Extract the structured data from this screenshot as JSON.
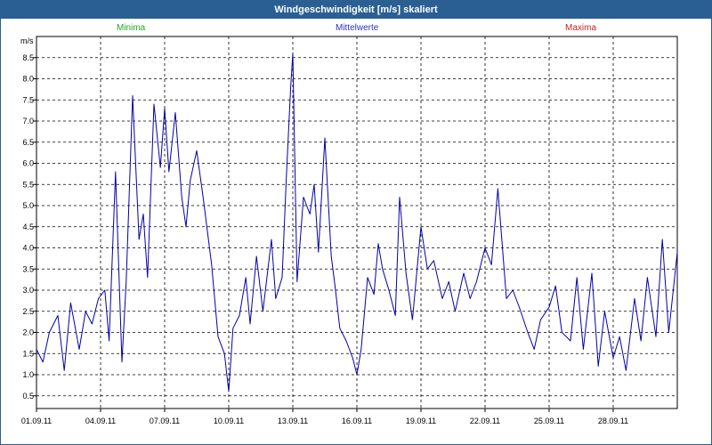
{
  "window": {
    "title": "Windgeschwindigkeit [m/s] skaliert"
  },
  "legend": {
    "min": "Minima",
    "mean": "Mittelwerte",
    "max": "Maxima"
  },
  "colors": {
    "min": "#22aa22",
    "mean": "#3030cc",
    "max": "#cc2222",
    "series": "#0000aa",
    "title_bg": "#2a5f93"
  },
  "chart_data": {
    "type": "line",
    "title": "Windgeschwindigkeit [m/s] skaliert",
    "ylabel": "m/s",
    "xlabel": "",
    "ylim": [
      0.2,
      9.0
    ],
    "y_ticks": [
      0.5,
      1.0,
      1.5,
      2.0,
      2.5,
      3.0,
      3.5,
      4.0,
      4.5,
      5.0,
      5.5,
      6.0,
      6.5,
      7.0,
      7.5,
      8.0,
      8.5
    ],
    "y_tick_labels": [
      "0.5",
      "1.0",
      "1.5",
      "2.0",
      "2.5",
      "3.0",
      "3.5",
      "4.0",
      "4.5",
      "5.0",
      "5.5",
      "6.0",
      "6.5",
      "7.0",
      "7.5",
      "8.0",
      "8.5"
    ],
    "x_ticks_day": [
      1,
      4,
      7,
      10,
      13,
      16,
      19,
      22,
      25,
      28
    ],
    "x_tick_labels": [
      "01.09.11",
      "04.09.11",
      "07.09.11",
      "10.09.11",
      "13.09.11",
      "16.09.11",
      "19.09.11",
      "22.09.11",
      "25.09.11",
      "28.09.11"
    ],
    "xlim_day": [
      1,
      31
    ],
    "grid": true,
    "series": [
      {
        "x_day": [
          1.0,
          1.3,
          1.6,
          2.0,
          2.3,
          2.6,
          3.0,
          3.3,
          3.6,
          3.9,
          4.2,
          4.4,
          4.7,
          5.0,
          5.2,
          5.5,
          5.8,
          6.0,
          6.2,
          6.5,
          6.8,
          7.0,
          7.2,
          7.5,
          7.8,
          8.0,
          8.2,
          8.5,
          8.8,
          9.0,
          9.2,
          9.5,
          9.8,
          10.0,
          10.2,
          10.5,
          10.8,
          11.0,
          11.3,
          11.6,
          12.0,
          12.2,
          12.5,
          12.7,
          12.9,
          13.0,
          13.2,
          13.5,
          13.8,
          14.0,
          14.2,
          14.5,
          14.8,
          15.0,
          15.2,
          15.5,
          15.8,
          16.0,
          16.2,
          16.5,
          16.8,
          17.0,
          17.2,
          17.5,
          17.8,
          18.0,
          18.3,
          18.6,
          19.0,
          19.3,
          19.6,
          20.0,
          20.3,
          20.6,
          21.0,
          21.3,
          21.6,
          22.0,
          22.3,
          22.6,
          23.0,
          23.3,
          23.6,
          24.0,
          24.3,
          24.6,
          25.0,
          25.3,
          25.6,
          26.0,
          26.3,
          26.6,
          27.0,
          27.3,
          27.6,
          28.0,
          28.3,
          28.6,
          29.0,
          29.3,
          29.6,
          30.0,
          30.3,
          30.6,
          31.0
        ],
        "values": [
          1.6,
          1.3,
          2.0,
          2.4,
          1.1,
          2.7,
          1.6,
          2.5,
          2.2,
          2.8,
          3.0,
          1.8,
          5.8,
          1.3,
          3.2,
          7.6,
          4.2,
          4.8,
          3.3,
          7.4,
          5.9,
          7.3,
          5.8,
          7.2,
          5.2,
          4.5,
          5.6,
          6.3,
          5.2,
          4.4,
          3.6,
          1.9,
          1.5,
          0.6,
          2.1,
          2.4,
          3.3,
          2.2,
          3.8,
          2.5,
          4.2,
          2.8,
          3.3,
          5.7,
          7.8,
          8.6,
          3.2,
          5.2,
          4.8,
          5.5,
          3.9,
          6.6,
          3.8,
          3.0,
          2.1,
          1.8,
          1.4,
          1.0,
          1.6,
          3.3,
          2.9,
          4.1,
          3.5,
          3.0,
          2.4,
          5.2,
          3.4,
          2.3,
          4.5,
          3.5,
          3.7,
          2.8,
          3.2,
          2.5,
          3.4,
          2.8,
          3.2,
          4.0,
          3.6,
          5.4,
          2.8,
          3.0,
          2.6,
          2.0,
          1.6,
          2.3,
          2.6,
          3.1,
          2.0,
          1.8,
          3.3,
          1.6,
          3.4,
          1.2,
          2.5,
          1.4,
          1.9,
          1.1,
          2.8,
          1.8,
          3.3,
          1.9,
          4.2,
          2.0,
          3.9,
          2.1
        ]
      }
    ]
  }
}
